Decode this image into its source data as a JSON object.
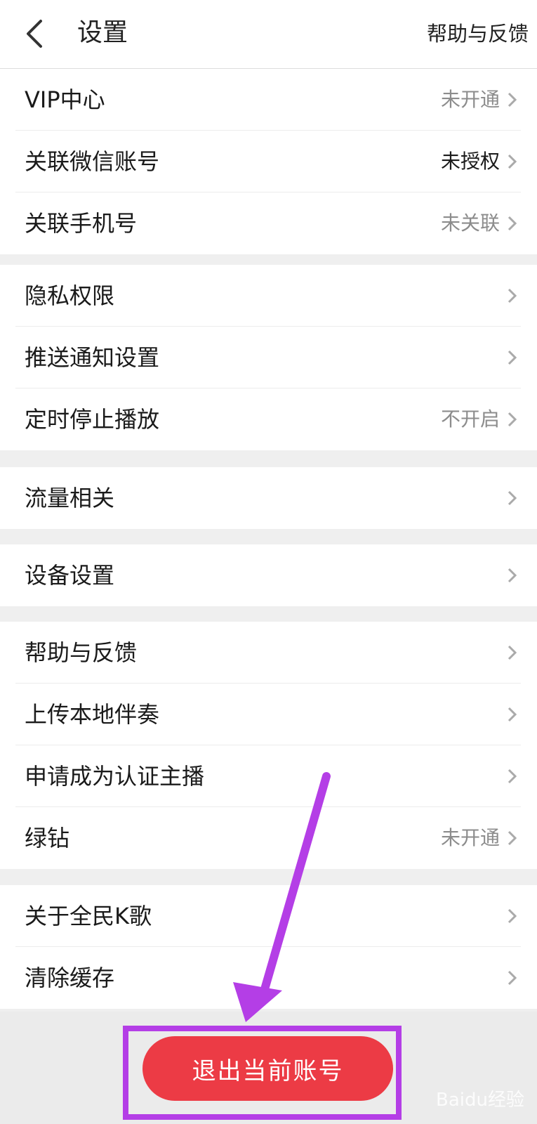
{
  "header": {
    "title": "设置",
    "right_link": "帮助与反馈",
    "back_icon": "chevron-left-icon"
  },
  "groups": [
    {
      "items": [
        {
          "label": "VIP中心",
          "value": "未开通"
        },
        {
          "label": "关联微信账号",
          "value": "未授权"
        },
        {
          "label": "关联手机号",
          "value": "未关联"
        }
      ]
    },
    {
      "items": [
        {
          "label": "隐私权限",
          "value": ""
        },
        {
          "label": "推送通知设置",
          "value": ""
        },
        {
          "label": "定时停止播放",
          "value": "不开启"
        }
      ]
    },
    {
      "items": [
        {
          "label": "流量相关",
          "value": ""
        }
      ]
    },
    {
      "items": [
        {
          "label": "设备设置",
          "value": ""
        }
      ]
    },
    {
      "items": [
        {
          "label": "帮助与反馈",
          "value": ""
        },
        {
          "label": "上传本地伴奏",
          "value": ""
        },
        {
          "label": "申请成为认证主播",
          "value": ""
        },
        {
          "label": "绿钻",
          "value": "未开通"
        }
      ]
    },
    {
      "items": [
        {
          "label": "关于全民K歌",
          "value": ""
        },
        {
          "label": "清除缓存",
          "value": ""
        }
      ]
    }
  ],
  "logout_label": "退出当前账号",
  "watermark": "Baidu经验",
  "colors": {
    "accent": "#ec3b45",
    "annotation": "#b43ee6"
  }
}
